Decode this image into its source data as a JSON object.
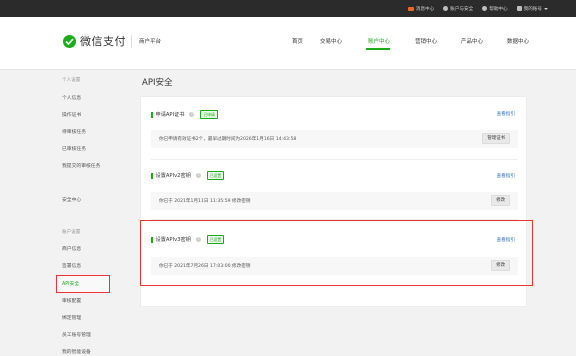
{
  "topbar": {
    "messages": "消息中心",
    "security": "账户与安全",
    "help": "帮助中心",
    "account": "我的账号"
  },
  "header": {
    "logo_text": "微信支付",
    "platform": "商户平台",
    "nav": [
      "首页",
      "交易中心",
      "账户中心",
      "营销中心",
      "产品中心",
      "数据中心"
    ],
    "active_nav": "账户中心"
  },
  "sidebar": {
    "group_personal": "个人设置",
    "personal_items": [
      "个人信息",
      "操作证书",
      "待审核任务",
      "已审核任务",
      "我提交的审核任务"
    ],
    "security_item": "安全中心",
    "group_account": "账户设置",
    "account_items": [
      "商户信息",
      "签署信息",
      "API安全",
      "审核配置",
      "绑定管理",
      "员工账号管理",
      "我的智能设备"
    ]
  },
  "main": {
    "title": "API安全",
    "sections": [
      {
        "title": "申请API证书",
        "badge": "已申请",
        "guide": "查看指引",
        "info": "你已申请有效证书2个，最早过期时间为2026年1月16日 14:43:58",
        "button": "管理证书"
      },
      {
        "title": "设置APIv2密钥",
        "badge": "已设置",
        "guide": "查看指引",
        "info": "你已于 2021年1月11日 11:35:59 修改密钥",
        "button": "修改"
      },
      {
        "title": "设置APIv3密钥",
        "badge": "已设置",
        "guide": "查看指引",
        "info": "你已于 2021年7月26日 17:03:00 修改密钥",
        "button": "修改"
      }
    ]
  },
  "colors": {
    "brand_green": "#1aad19",
    "highlight_red": "#ee3333",
    "link_blue": "#2a6ec7"
  }
}
